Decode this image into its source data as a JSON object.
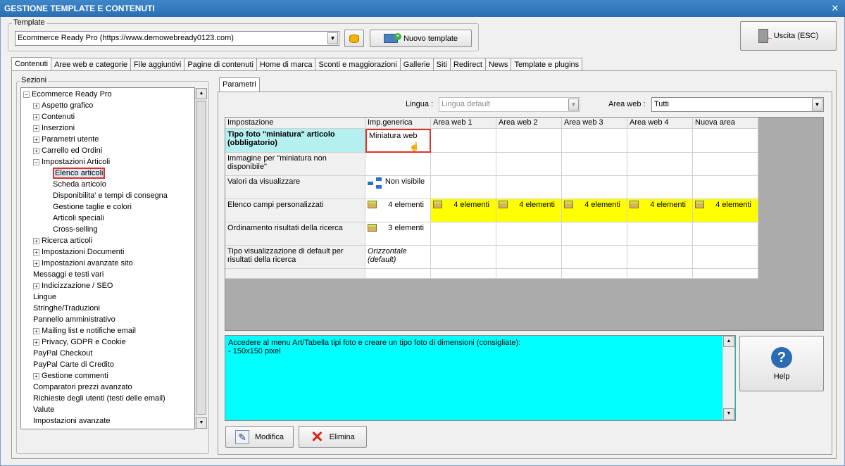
{
  "window": {
    "title": "GESTIONE TEMPLATE E CONTENUTI",
    "close": "✕"
  },
  "template": {
    "legend": "Template",
    "value": "Ecommerce Ready Pro (https://www.demowebready0123.com)",
    "new_label": "Nuovo template",
    "exit_label": "Uscita (ESC)"
  },
  "tabs": [
    "Contenuti",
    "Aree web e categorie",
    "File aggiuntivi",
    "Pagine di contenuti",
    "Home di marca",
    "Sconti e maggiorazioni",
    "Gallerie",
    "Siti",
    "Redirect",
    "News",
    "Template e plugins"
  ],
  "sections": {
    "legend": "Sezioni",
    "items": [
      {
        "label": "Ecommerce Ready Pro",
        "level": 0,
        "sign": "⊟"
      },
      {
        "label": "Aspetto grafico",
        "level": 1,
        "sign": "+"
      },
      {
        "label": "Contenuti",
        "level": 1,
        "sign": "+"
      },
      {
        "label": "Inserzioni",
        "level": 1,
        "sign": "+"
      },
      {
        "label": "Parametri utente",
        "level": 1,
        "sign": "+"
      },
      {
        "label": "Carrello ed Ordini",
        "level": 1,
        "sign": "+"
      },
      {
        "label": "Impostazioni Articoli",
        "level": 1,
        "sign": "−"
      },
      {
        "label": "Elenco articoli",
        "level": 2,
        "sign": "",
        "selected": true
      },
      {
        "label": "Scheda articolo",
        "level": 2,
        "sign": ""
      },
      {
        "label": "Disponibilita' e tempi di consegna",
        "level": 2,
        "sign": ""
      },
      {
        "label": "Gestione taglie e colori",
        "level": 2,
        "sign": ""
      },
      {
        "label": "Articoli speciali",
        "level": 2,
        "sign": ""
      },
      {
        "label": "Cross-selling",
        "level": 2,
        "sign": ""
      },
      {
        "label": "Ricerca articoli",
        "level": 1,
        "sign": "+"
      },
      {
        "label": "Impostazioni Documenti",
        "level": 1,
        "sign": "+"
      },
      {
        "label": "Impostazioni avanzate sito",
        "level": 1,
        "sign": "+"
      },
      {
        "label": "Messaggi e testi vari",
        "level": 1,
        "sign": ""
      },
      {
        "label": "Indicizzazione / SEO",
        "level": 1,
        "sign": "+"
      },
      {
        "label": "Lingue",
        "level": 1,
        "sign": ""
      },
      {
        "label": "Stringhe/Traduzioni",
        "level": 1,
        "sign": ""
      },
      {
        "label": "Pannello amministrativo",
        "level": 1,
        "sign": ""
      },
      {
        "label": "Mailing list e notifiche email",
        "level": 1,
        "sign": "+"
      },
      {
        "label": "Privacy, GDPR e Cookie",
        "level": 1,
        "sign": "+"
      },
      {
        "label": "PayPal Checkout",
        "level": 1,
        "sign": ""
      },
      {
        "label": "PayPal Carte di Credito",
        "level": 1,
        "sign": ""
      },
      {
        "label": "Gestione commenti",
        "level": 1,
        "sign": "+"
      },
      {
        "label": "Comparatori prezzi avanzato",
        "level": 1,
        "sign": ""
      },
      {
        "label": "Richieste degli utenti (testi delle email)",
        "level": 1,
        "sign": ""
      },
      {
        "label": "Valute",
        "level": 1,
        "sign": ""
      },
      {
        "label": "Impostazioni avanzate",
        "level": 1,
        "sign": ""
      }
    ]
  },
  "params": {
    "tab": "Parametri",
    "lingua_label": "Lingua :",
    "lingua_value": "Lingua default",
    "area_label": "Area web :",
    "area_value": "Tutti"
  },
  "grid": {
    "headers": [
      "Impostazione",
      "Imp.generica",
      "Area web 1",
      "Area web 2",
      "Area web 3",
      "Area web 4",
      "Nuova area"
    ],
    "rows": [
      {
        "label": "Tipo foto \"miniatura\" articolo (obbligatorio)",
        "generic": "Miniatura web"
      },
      {
        "label": "Immagine per \"miniatura non disponibile\"",
        "generic": ""
      },
      {
        "label": "Valori da visualizzare",
        "generic": "Non visibile"
      },
      {
        "label": "Elenco campi personalizzati",
        "generic": "4 elementi",
        "areas": [
          "4 elementi",
          "4 elementi",
          "4 elementi",
          "4 elementi",
          "4 elementi"
        ]
      },
      {
        "label": "Ordinamento risultati della ricerca",
        "generic": "3 elementi"
      },
      {
        "label": "Tipo visualizzazione di default per risultati della ricerca",
        "generic": "Orizzontale (default)"
      }
    ]
  },
  "hint": {
    "line1": "Accedere al menu Art/Tabella tipi foto e creare un tipo foto di dimensioni (consigliate):",
    "line2": "- 150x150 pixel"
  },
  "actions": {
    "help": "Help",
    "edit": "Modifica",
    "delete": "Elimina"
  }
}
